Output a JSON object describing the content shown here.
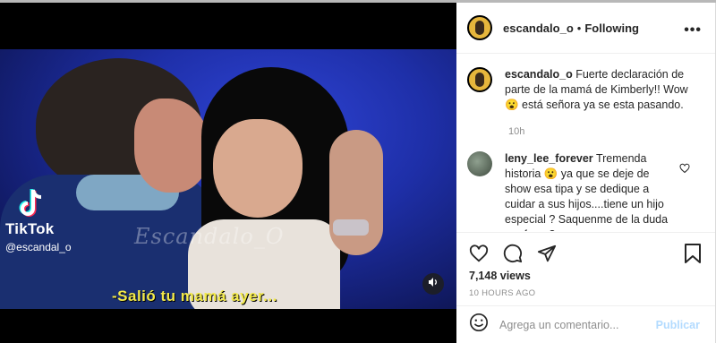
{
  "video": {
    "tiktok_brand": "TikTok",
    "tiktok_handle": "@escandal_o",
    "watermark": "Escandalo_O",
    "subtitle": "-Salió tu mamá ayer..."
  },
  "header": {
    "username": "escandalo_o",
    "separator": "•",
    "follow_status": "Following",
    "more_glyph": "•••"
  },
  "caption": {
    "username": "escandalo_o",
    "text": "Fuerte declaración de parte de la mamá de Kimberly!! Wow 😮 está señora ya se esta pasando.",
    "time": "10h"
  },
  "comments": [
    {
      "username": "leny_lee_forever",
      "text": "Tremenda historia 😮 ya que se deje de show esa tipa y se dedique a cuidar a sus hijos....tiene un hijo especial ? Saquenme de la duda por favor?"
    }
  ],
  "stats": {
    "views": "7,148 views",
    "posted": "10 HOURS AGO"
  },
  "add_comment": {
    "placeholder": "Agrega un comentario...",
    "post_label": "Publicar"
  },
  "colors": {
    "post_disabled": "#b3dbff",
    "subtitle": "#f2e94a",
    "muted": "#8e8e8e"
  },
  "icons": [
    "tiktok-icon",
    "sound-icon",
    "heart-icon",
    "comment-icon",
    "share-icon",
    "bookmark-icon",
    "emoji-icon",
    "more-icon"
  ]
}
